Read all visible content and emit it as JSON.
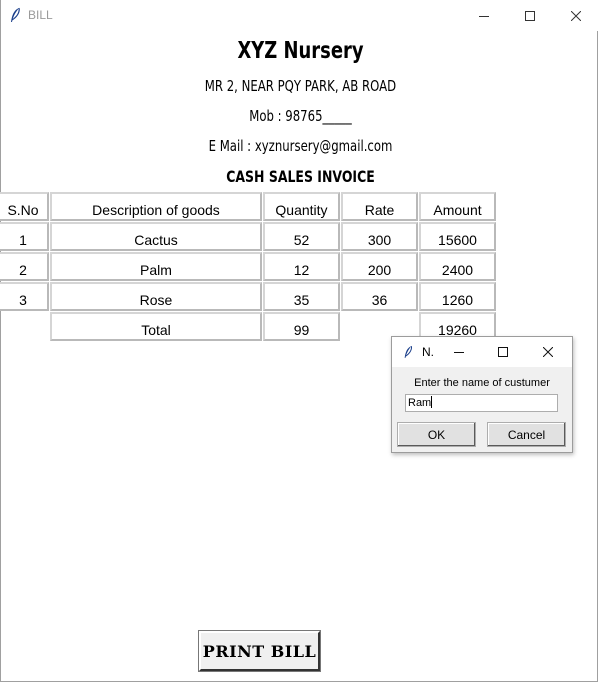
{
  "window": {
    "title": "BILL"
  },
  "header": {
    "shop_name": "XYZ Nursery",
    "address": "MR 2, NEAR PQY PARK, AB ROAD",
    "mobile": "Mob : 98765_____",
    "email": "E Mail : xyznursery@gmail.com",
    "invoice_title": "CASH SALES INVOICE"
  },
  "table": {
    "headers": [
      "S.No",
      "Description of goods",
      "Quantity",
      "Rate",
      "Amount"
    ],
    "rows": [
      [
        "1",
        "Cactus",
        "52",
        "300",
        "15600"
      ],
      [
        "2",
        "Palm",
        "12",
        "200",
        "2400"
      ],
      [
        "3",
        "Rose",
        "35",
        "36",
        "1260"
      ]
    ],
    "total": {
      "label": "Total",
      "quantity": "99",
      "amount": "19260"
    }
  },
  "print_button": "PRINT BILL",
  "dialog": {
    "title": "N.",
    "prompt": "Enter the name of custumer",
    "input_value": "Ram",
    "ok_label": "OK",
    "cancel_label": "Cancel"
  },
  "icons": {
    "app": "feather-icon",
    "minimize": "minimize-icon",
    "maximize": "maximize-icon",
    "close": "close-icon"
  }
}
